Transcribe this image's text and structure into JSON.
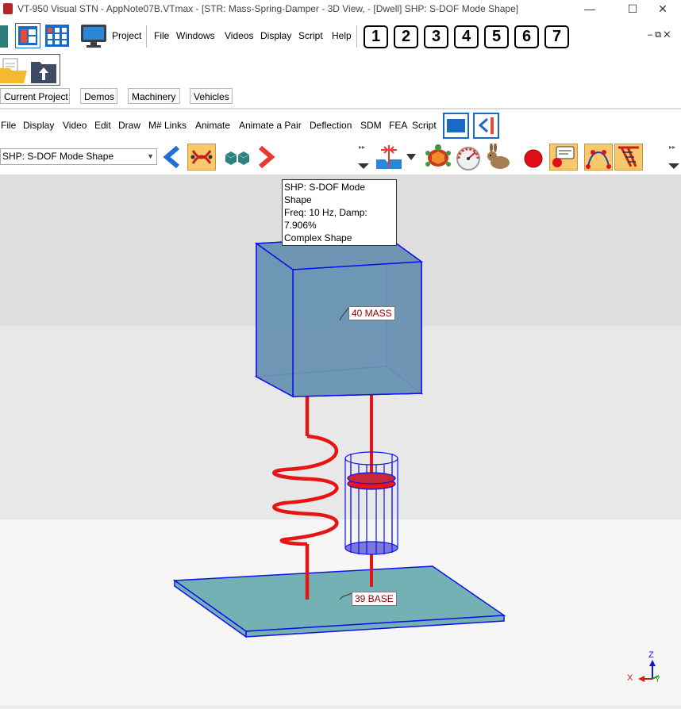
{
  "window": {
    "title": "VT-950 Visual STN - AppNote07B.VTmax - [STR: Mass-Spring-Damper - 3D View,  - [Dwell] SHP: S-DOF Mode Shape]",
    "minimize": "—",
    "maximize": "☐",
    "close": "✕"
  },
  "main_menu": {
    "items": [
      "Project",
      "File",
      "Windows",
      "Videos",
      "Display",
      "Script",
      "Help"
    ],
    "numbers": [
      "1",
      "2",
      "3",
      "4",
      "5",
      "6",
      "7"
    ],
    "mdi_controls": "– ⧉ ✕"
  },
  "project_tabs": [
    "Current Project",
    "Demos",
    "Machinery",
    "Vehicles"
  ],
  "window_menu": {
    "items": [
      "File",
      "Display",
      "Video",
      "Edit",
      "Draw",
      "M# Links",
      "Animate",
      "Animate a Pair",
      "Deflection",
      "SDM",
      "FEA",
      "Script"
    ]
  },
  "toolbar": {
    "shape_select": "SHP: S-DOF Mode Shape",
    "colors": {
      "accent_blue": "#1f6fd6",
      "accent_red": "#e8392e",
      "highlight": "#f7c96b"
    }
  },
  "viewport": {
    "info": [
      "SHP: S-DOF Mode Shape",
      "Freq: 10 Hz, Damp: 7.906%",
      "Complex Shape"
    ],
    "mass_label": "40 MASS",
    "base_label": "39 BASE",
    "axes": {
      "z": "Z",
      "x": "X",
      "y": "Y"
    },
    "colors": {
      "wire": "#1010ee",
      "fill": "#6e96b4",
      "spring": "#e81414",
      "axis_z": "#1515c8",
      "axis_x": "#d41818",
      "axis_y": "#12a012"
    }
  }
}
